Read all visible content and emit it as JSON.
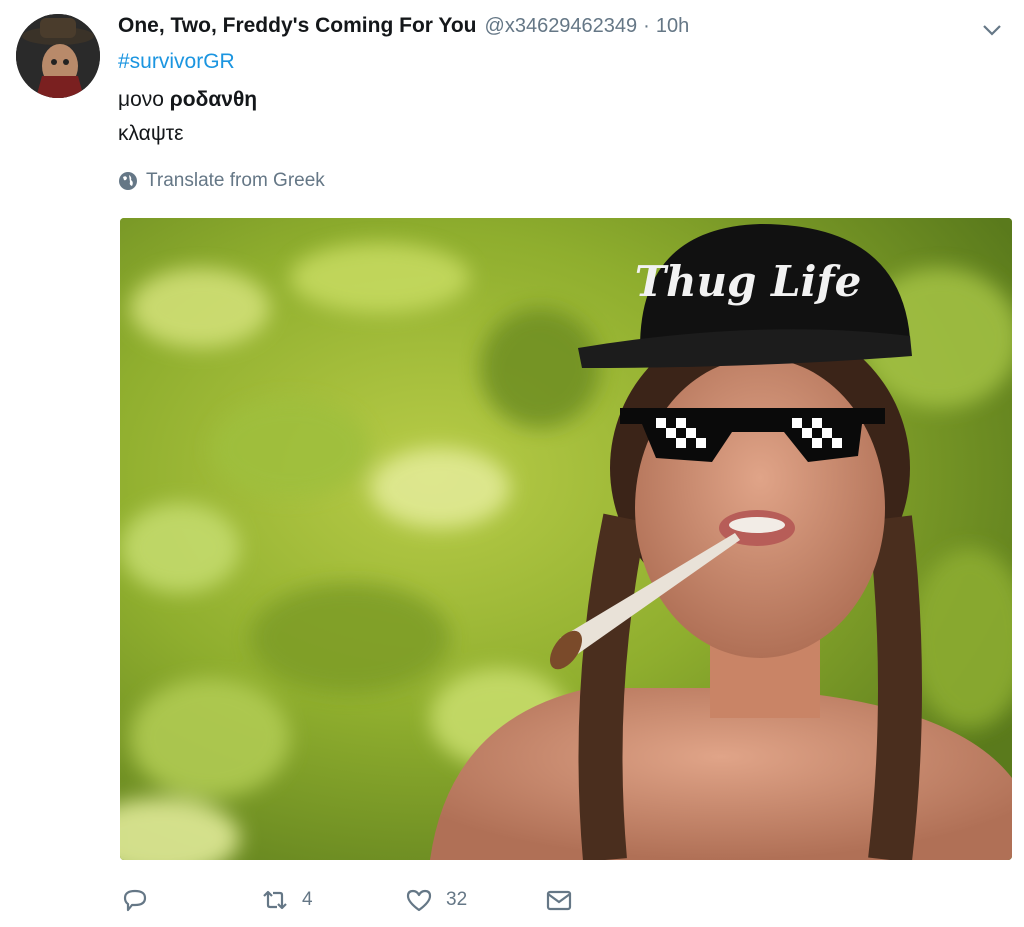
{
  "tweet": {
    "author_name": "One, Two, Freddy's Coming For You",
    "handle": "@x34629462349",
    "separator": "·",
    "time": "10h",
    "hashtag": "#survivorGR",
    "text_line1_plain": "μονο ",
    "text_line1_bold": "ροδανθη",
    "text_line2": "κλαψτε",
    "translate_label": "Translate from Greek",
    "image_overlay_text": "Thug Life"
  },
  "actions": {
    "reply_count": "",
    "retweet_count": "4",
    "like_count": "32"
  },
  "colors": {
    "link": "#1b95e0",
    "muted": "#657786",
    "text": "#14171a"
  },
  "icons": [
    "caret-down-icon",
    "globe-icon",
    "reply-icon",
    "retweet-icon",
    "heart-icon",
    "envelope-icon"
  ]
}
